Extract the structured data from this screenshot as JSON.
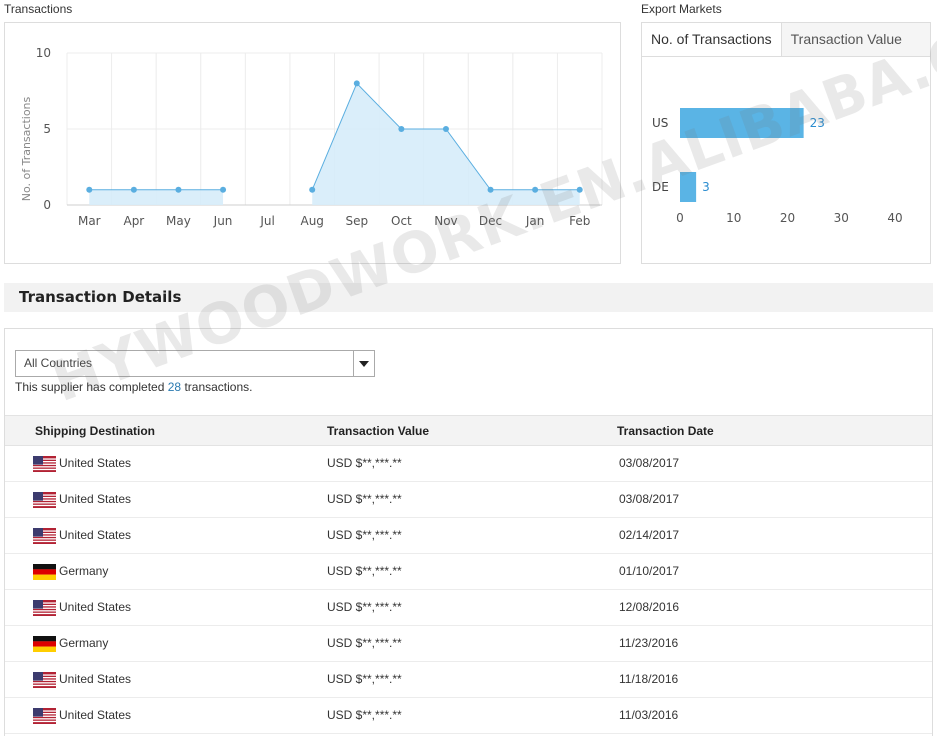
{
  "transactions": {
    "section_label": "Transactions"
  },
  "export_markets": {
    "section_label": "Export Markets",
    "tabs": [
      {
        "label": "No. of Transactions",
        "active": true
      },
      {
        "label": "Transaction Value",
        "active": false
      }
    ]
  },
  "chart_data": [
    {
      "type": "line",
      "title": "",
      "xlabel": "",
      "ylabel": "No. of Transactions",
      "categories": [
        "Mar",
        "Apr",
        "May",
        "Jun",
        "Jul",
        "Aug",
        "Sep",
        "Oct",
        "Nov",
        "Dec",
        "Jan",
        "Feb"
      ],
      "values": [
        1,
        1,
        1,
        1,
        null,
        1,
        8,
        5,
        5,
        1,
        1,
        1
      ],
      "ylim": [
        0,
        10
      ],
      "yticks": [
        0,
        5,
        10
      ],
      "grid": true,
      "area_fill": true,
      "color": "#5aaee0"
    },
    {
      "type": "bar",
      "orientation": "horizontal",
      "categories": [
        "US",
        "DE"
      ],
      "values": [
        23,
        3
      ],
      "xlim": [
        0,
        40
      ],
      "xticks": [
        0,
        10,
        20,
        30,
        40
      ],
      "data_labels": [
        "23",
        "3"
      ],
      "color": "#5ab4e5"
    }
  ],
  "details": {
    "title": "Transaction Details",
    "filter_value": "All Countries",
    "summary_prefix": "This supplier has completed ",
    "summary_count": "28",
    "summary_suffix": " transactions.",
    "columns": [
      "Shipping Destination",
      "Transaction Value",
      "Transaction Date"
    ],
    "rows": [
      {
        "flag": "us-flag",
        "country": "United States",
        "value": "USD $**,***.**",
        "date": "03/08/2017"
      },
      {
        "flag": "us-flag",
        "country": "United States",
        "value": "USD $**,***.**",
        "date": "03/08/2017"
      },
      {
        "flag": "us-flag",
        "country": "United States",
        "value": "USD $**,***.**",
        "date": "02/14/2017"
      },
      {
        "flag": "de-flag",
        "country": "Germany",
        "value": "USD $**,***.**",
        "date": "01/10/2017"
      },
      {
        "flag": "us-flag",
        "country": "United States",
        "value": "USD $**,***.**",
        "date": "12/08/2016"
      },
      {
        "flag": "de-flag",
        "country": "Germany",
        "value": "USD $**,***.**",
        "date": "11/23/2016"
      },
      {
        "flag": "us-flag",
        "country": "United States",
        "value": "USD $**,***.**",
        "date": "11/18/2016"
      },
      {
        "flag": "us-flag",
        "country": "United States",
        "value": "USD $**,***.**",
        "date": "11/03/2016"
      }
    ]
  },
  "watermark": "HYWOODWORK.EN.ALIBABA.COM"
}
